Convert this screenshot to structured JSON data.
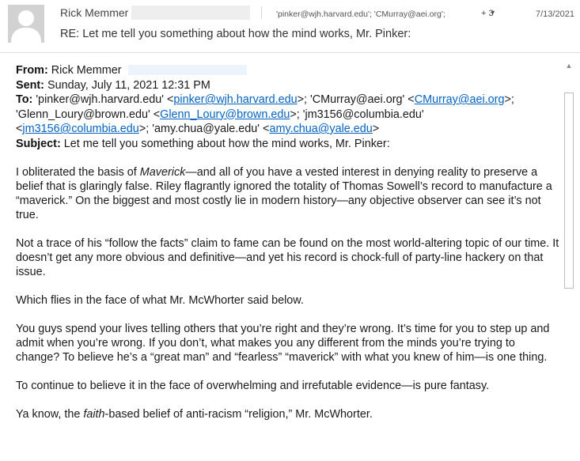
{
  "header": {
    "sender_name": "Rick Memmer",
    "recipients_preview": "'pinker@wjh.harvard.edu'; 'CMurray@aei.org';",
    "more_count": "+ 3",
    "date": "7/13/2021",
    "subject": "RE: Let me tell you something about how the mind works, Mr. Pinker:"
  },
  "meta": {
    "from_label": "From:",
    "from_value": "Rick Memmer",
    "sent_label": "Sent:",
    "sent_value": "Sunday, July 11, 2021 12:31 PM",
    "to_label": "To:",
    "to_1_name": "'pinker@wjh.harvard.edu' <",
    "to_1_link": "pinker@wjh.harvard.edu",
    "to_1_end": ">; 'CMurray@aei.org' <",
    "to_2_link": "CMurray@aei.org",
    "to_2_end": ">;",
    "to_3_name": "'Glenn_Loury@brown.edu' <",
    "to_3_link": "Glenn_Loury@brown.edu",
    "to_3_end": ">; 'jm3156@columbia.edu'",
    "to_4_start": "<",
    "to_4_link": "jm3156@columbia.edu",
    "to_4_end": ">; 'amy.chua@yale.edu' <",
    "to_5_link": "amy.chua@yale.edu",
    "to_5_end": ">",
    "subject_label": "Subject:",
    "subject_value": "Let me tell you something about how the mind works, Mr. Pinker:"
  },
  "body": {
    "p1_a": "I obliterated the basis of ",
    "p1_italic": "Maverick",
    "p1_b": "—and all of you have a vested interest in denying reality to preserve a belief that is glaringly false. Riley flagrantly ignored the totality of Thomas Sowell’s record to manufacture a “maverick.” On the biggest and most costly lie in modern history—any objective observer can see it’s not true.",
    "p2": "Not a trace of his “follow the facts” claim to fame can be found on the most world-altering topic of our time. It doesn’t get any more obvious and definitive—and yet his record is chock-full of party-line hackery on that issue.",
    "p3": "Which flies in the face of what Mr. McWhorter said below.",
    "p4": "You guys spend your lives telling others that you’re right and they’re wrong. It’s time for you to step up and admit when you’re wrong. If you don’t, what makes you any different from the minds you’re trying to change? To believe he’s a “great man” and “fearless” “maverick” with what you knew of him—is one thing.",
    "p5": "To continue to believe it in the face of overwhelming and irrefutable evidence—is pure fantasy.",
    "p6_a": "Ya know, the ",
    "p6_italic": "faith",
    "p6_b": "-based belief of anti-racism “religion,” Mr. McWhorter."
  },
  "icons": {
    "avatar": "person-silhouette-icon",
    "expand": "chevron-down-icon",
    "scroll_up": "scroll-up-arrow-icon"
  },
  "colors": {
    "link": "#0563c1",
    "avatar_bg": "#d2d2d2"
  }
}
